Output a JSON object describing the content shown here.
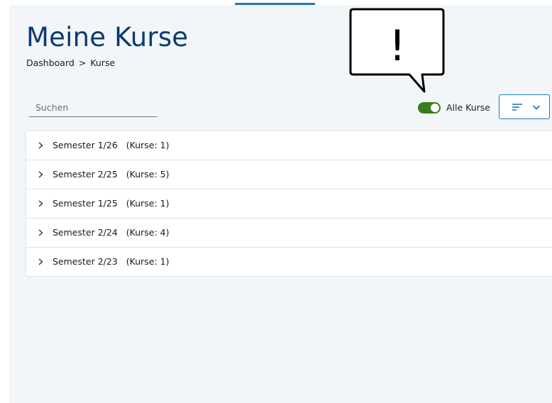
{
  "page": {
    "title": "Meine Kurse",
    "breadcrumb": [
      "Dashboard",
      "Kurse"
    ],
    "breadcrumb_separator": ">"
  },
  "search": {
    "placeholder": "Suchen",
    "value": ""
  },
  "filter": {
    "toggle_label": "Alle Kurse",
    "toggle_on": true
  },
  "semesters": [
    {
      "label": "Semester 1/26",
      "count": "(Kurse: 1)"
    },
    {
      "label": "Semester 2/25",
      "count": "(Kurse: 5)"
    },
    {
      "label": "Semester 1/25",
      "count": "(Kurse: 1)"
    },
    {
      "label": "Semester 2/24",
      "count": "(Kurse: 4)"
    },
    {
      "label": "Semester 2/23",
      "count": "(Kurse: 1)"
    }
  ],
  "callout": {
    "text": "!"
  },
  "colors": {
    "title": "#0c3a73",
    "accent": "#1f78bd",
    "toggle_on": "#3a7d1e",
    "background": "#f2f6f9"
  }
}
